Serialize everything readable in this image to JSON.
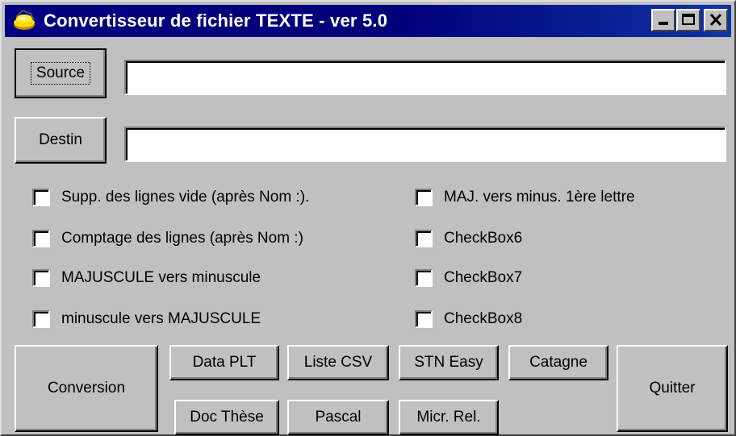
{
  "window": {
    "title": "Convertisseur de fichier TEXTE - ver 5.0",
    "title_bar_color": "#000080",
    "icon": "app-icon"
  },
  "files": {
    "source_label": "Source",
    "source_value": "",
    "destin_label": "Destin",
    "destin_value": ""
  },
  "options": {
    "left": [
      {
        "label": "Supp. des lignes vide (après Nom :).",
        "checked": false
      },
      {
        "label": "Comptage des lignes (après Nom :)",
        "checked": false
      },
      {
        "label": "MAJUSCULE vers minuscule",
        "checked": false
      },
      {
        "label": "minuscule vers MAJUSCULE",
        "checked": false
      }
    ],
    "right": [
      {
        "label": "MAJ. vers minus. 1ère lettre",
        "checked": false
      },
      {
        "label": "CheckBox6",
        "checked": false
      },
      {
        "label": "CheckBox7",
        "checked": false
      },
      {
        "label": "CheckBox8",
        "checked": false
      }
    ]
  },
  "buttons": {
    "conversion": "Conversion",
    "data_plt": "Data PLT",
    "liste_csv": "Liste CSV",
    "stn_easy": "STN Easy",
    "catagne": "Catagne",
    "doc_these": "Doc Thèse",
    "pascal": "Pascal",
    "micr_rel": "Micr. Rel.",
    "quitter": "Quitter"
  }
}
